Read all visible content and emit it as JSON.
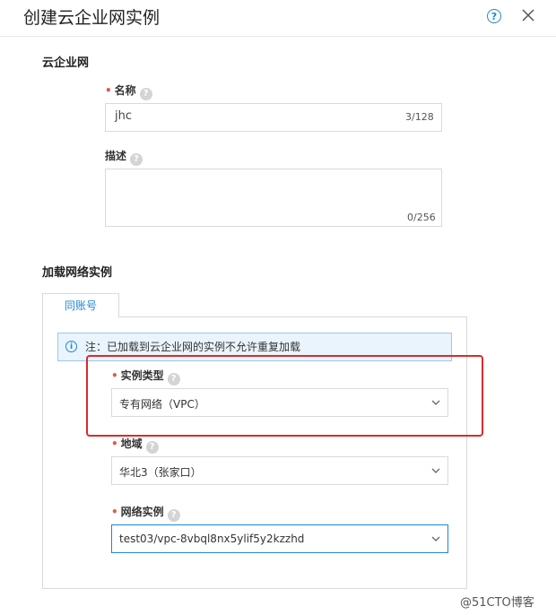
{
  "dialog": {
    "title": "创建云企业网实例",
    "help_icon": "question-circle-icon",
    "help_glyph": "?",
    "close_icon": "close-icon"
  },
  "section_cen": {
    "title": "云企业网",
    "name_label": "名称",
    "name_value": "jhc",
    "name_counter": "3/128",
    "desc_label": "描述",
    "desc_value": "",
    "desc_counter": "0/256"
  },
  "section_attach": {
    "title": "加载网络实例",
    "tab_label": "同账号",
    "notice_glyph": "i",
    "notice": "注：已加载到云企业网的实例不允许重复加载",
    "instance_type_label": "实例类型",
    "instance_type_value": "专有网络（VPC）",
    "region_label": "地域",
    "region_value": "华北3（张家口）",
    "network_instance_label": "网络实例",
    "network_instance_value": "test03/vpc-8vbql8nx5ylif5y2kzzhd"
  },
  "required_mark": "•",
  "tooltip_glyph": "?",
  "colors": {
    "accent": "#1e86d6",
    "required": "#e05b4b",
    "annotation_box": "#d92b2b"
  },
  "watermark": "@51CTO博客"
}
